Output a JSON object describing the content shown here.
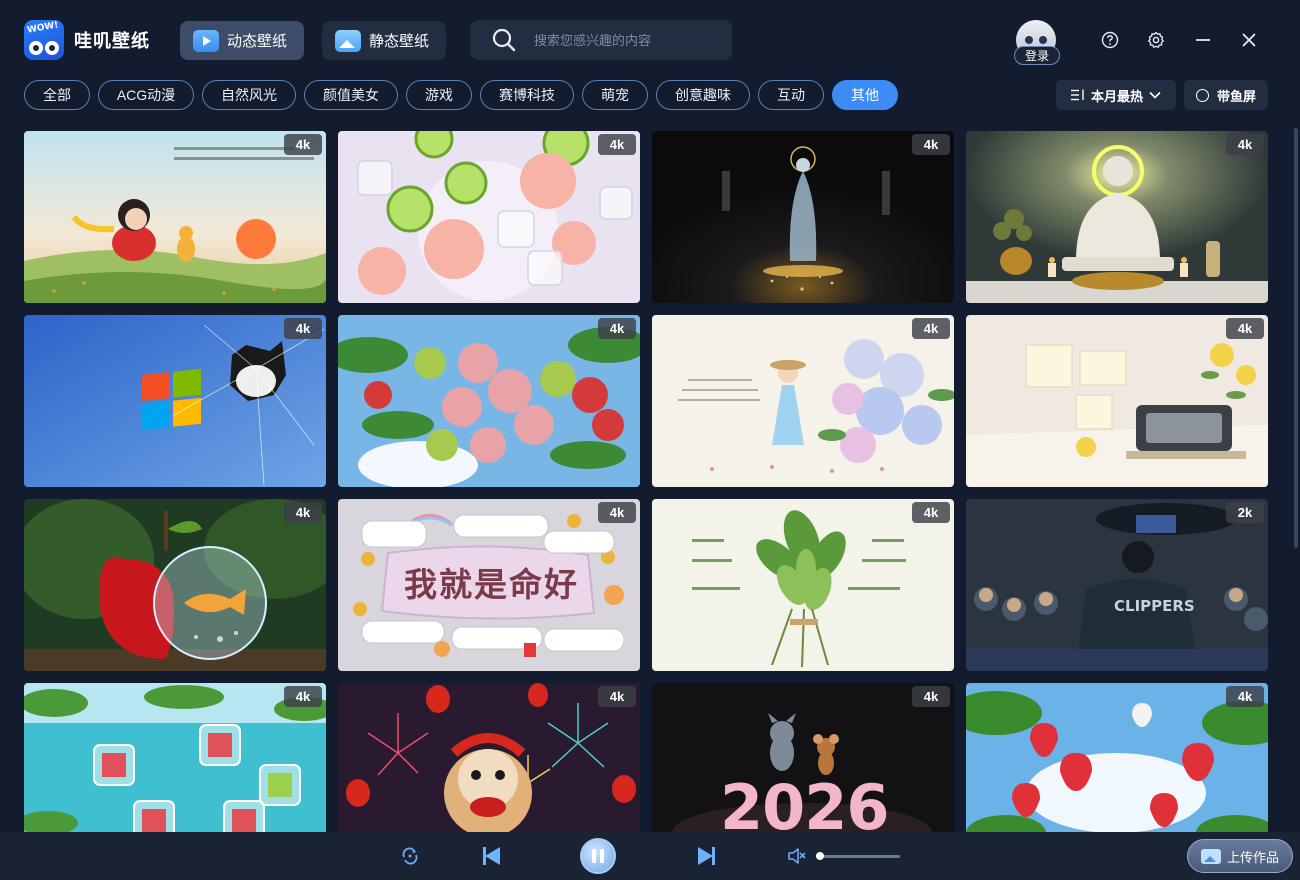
{
  "app": {
    "name": "哇叽壁纸",
    "logo_text": "WOW!"
  },
  "mode_tabs": [
    {
      "label": "动态壁纸",
      "active": true,
      "icon": "video-icon"
    },
    {
      "label": "静态壁纸",
      "active": false,
      "icon": "photo-icon"
    }
  ],
  "search": {
    "placeholder": "搜索您感兴趣的内容"
  },
  "user": {
    "login_label": "登录"
  },
  "categories": [
    {
      "label": "全部",
      "active": false
    },
    {
      "label": "ACG动漫",
      "active": false
    },
    {
      "label": "自然风光",
      "active": false
    },
    {
      "label": "颜值美女",
      "active": false
    },
    {
      "label": "游戏",
      "active": false
    },
    {
      "label": "赛博科技",
      "active": false
    },
    {
      "label": "萌宠",
      "active": false
    },
    {
      "label": "创意趣味",
      "active": false
    },
    {
      "label": "互动",
      "active": false
    },
    {
      "label": "其他",
      "active": true
    }
  ],
  "sort": {
    "label": "本月最热"
  },
  "fish_screen": {
    "label": "带鱼屏",
    "checked": false
  },
  "wallpapers": [
    {
      "resolution": "4k",
      "theme": "girl-cat-sunset"
    },
    {
      "resolution": "4k",
      "theme": "peach-lime-ice"
    },
    {
      "resolution": "4k",
      "theme": "guanyin-statue"
    },
    {
      "resolution": "4k",
      "theme": "buddha-statue"
    },
    {
      "resolution": "4k",
      "theme": "windows-xp-cat"
    },
    {
      "resolution": "4k",
      "theme": "lychee-tree"
    },
    {
      "resolution": "4k",
      "theme": "girl-hydrangea"
    },
    {
      "resolution": "4k",
      "theme": "desk-sticky-notes"
    },
    {
      "resolution": "4k",
      "theme": "apple-fishbowl"
    },
    {
      "resolution": "4k",
      "theme": "lucky-text",
      "caption": "我就是命好"
    },
    {
      "resolution": "4k",
      "theme": "green-leaves"
    },
    {
      "resolution": "2k",
      "theme": "clippers-stadium",
      "caption": "CLIPPERS"
    },
    {
      "resolution": "4k",
      "theme": "fruit-ice-cubes"
    },
    {
      "resolution": "4k",
      "theme": "lion-dance-fireworks"
    },
    {
      "resolution": "4k",
      "theme": "tom-jerry",
      "caption": "2026"
    },
    {
      "resolution": "4k",
      "theme": "strawberries"
    }
  ],
  "player": {
    "volume": 0.0
  },
  "upload": {
    "label": "上传作品"
  },
  "colors": {
    "background": "#131c2e",
    "accent": "#3d8cf5",
    "tab_active": "#3d4c69"
  }
}
